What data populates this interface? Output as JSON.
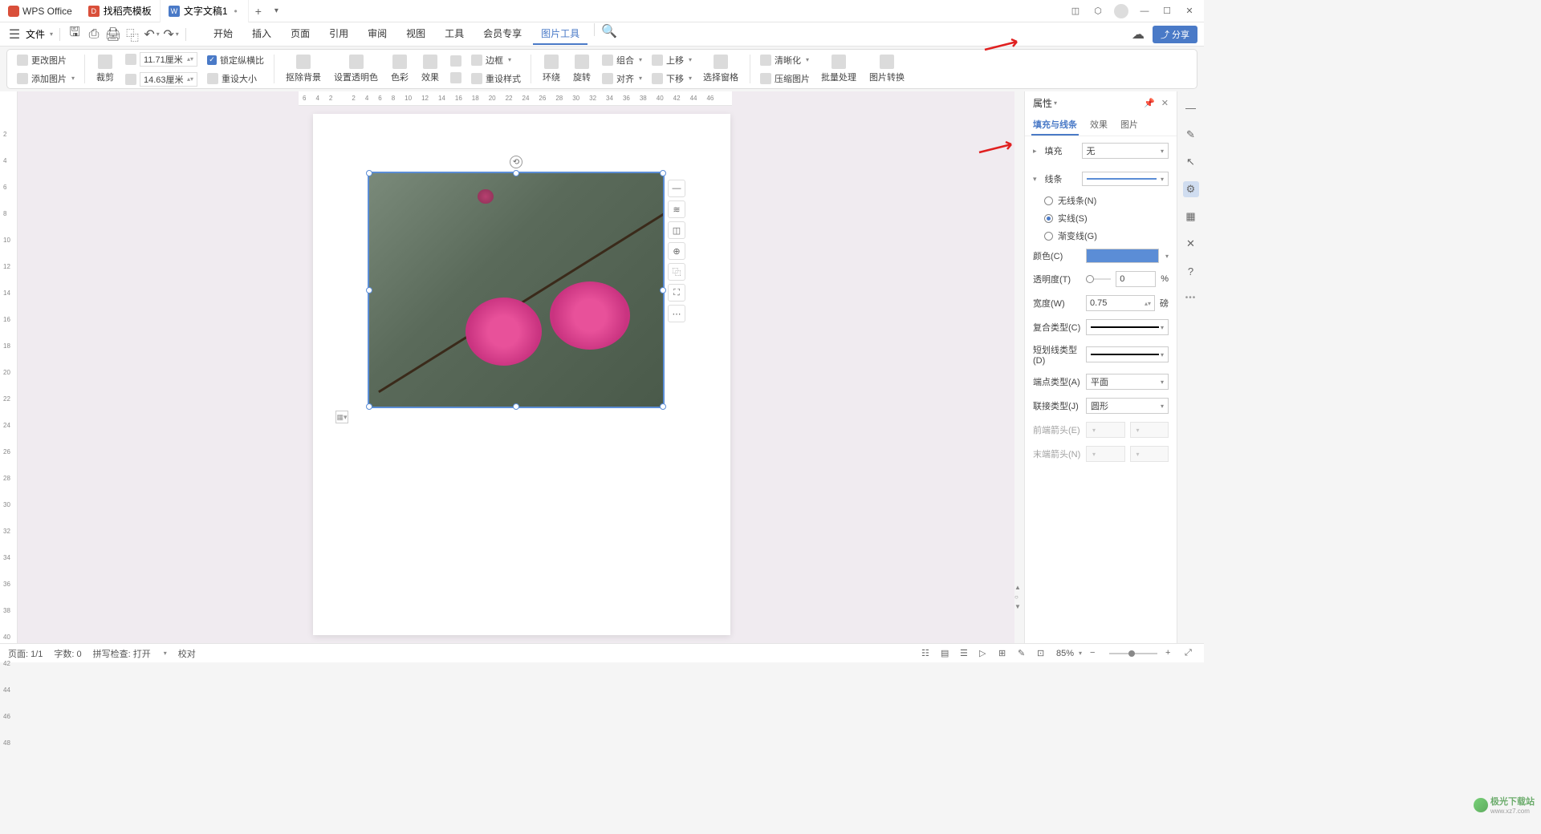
{
  "titlebar": {
    "app_name": "WPS Office",
    "tabs": [
      {
        "label": "找稻壳模板",
        "icon_bg": "#d94f3a",
        "icon_letter": "D"
      },
      {
        "label": "文字文稿1",
        "icon_bg": "#4a7ac7",
        "icon_letter": "W"
      }
    ]
  },
  "menubar": {
    "file_label": "文件",
    "tabs": [
      "开始",
      "插入",
      "页面",
      "引用",
      "审阅",
      "视图",
      "工具",
      "会员专享",
      "图片工具"
    ],
    "active_tab": "图片工具",
    "share_label": "分享"
  },
  "ribbon": {
    "change_pic": "更改图片",
    "add_pic": "添加图片",
    "crop": "裁剪",
    "width_val": "11.71厘米",
    "height_val": "14.63厘米",
    "lock_ratio": "锁定纵横比",
    "reset_size": "重设大小",
    "remove_bg": "抠除背景",
    "transparency": "设置透明色",
    "color": "色彩",
    "effect": "效果",
    "border": "边框",
    "reset_style": "重设样式",
    "wrap": "环绕",
    "rotate": "旋转",
    "combine": "组合",
    "align": "对齐",
    "move_up": "上移",
    "move_down": "下移",
    "selection": "选择窗格",
    "clarity": "清晰化",
    "compress": "压缩图片",
    "batch": "批量处理",
    "convert": "图片转换"
  },
  "hruler_marks": [
    "6",
    "4",
    "2",
    "",
    "2",
    "4",
    "6",
    "8",
    "10",
    "12",
    "14",
    "16",
    "18",
    "20",
    "22",
    "24",
    "26",
    "28",
    "30",
    "32",
    "34",
    "36",
    "38",
    "40",
    "42",
    "44",
    "46"
  ],
  "vruler_marks": [
    "",
    "2",
    "4",
    "6",
    "8",
    "10",
    "12",
    "14",
    "16",
    "18",
    "20",
    "22",
    "24",
    "26",
    "28",
    "30",
    "32",
    "34",
    "36",
    "38",
    "40",
    "42",
    "44",
    "46",
    "48"
  ],
  "properties": {
    "title": "属性",
    "tabs": [
      "填充与线条",
      "效果",
      "图片"
    ],
    "active_tab": "填充与线条",
    "fill_label": "填充",
    "fill_value": "无",
    "line_label": "线条",
    "radio_none": "无线条(N)",
    "radio_solid": "实线(S)",
    "radio_gradient": "渐变线(G)",
    "selected_radio": "solid",
    "color_label": "颜色(C)",
    "opacity_label": "透明度(T)",
    "opacity_value": "0",
    "opacity_unit": "%",
    "width_label": "宽度(W)",
    "width_value": "0.75",
    "width_unit": "磅",
    "compound_label": "复合类型(C)",
    "dash_label": "短划线类型(D)",
    "cap_label": "端点类型(A)",
    "cap_value": "平面",
    "join_label": "联接类型(J)",
    "join_value": "圆形",
    "arrow_start_label": "前端箭头(E)",
    "arrow_end_label": "末端箭头(N)"
  },
  "statusbar": {
    "page": "页面: 1/1",
    "words": "字数: 0",
    "spell": "拼写检查: 打开",
    "proof": "校对",
    "zoom": "85%"
  },
  "watermark": {
    "name": "极光下载站",
    "url": "www.xz7.com"
  }
}
